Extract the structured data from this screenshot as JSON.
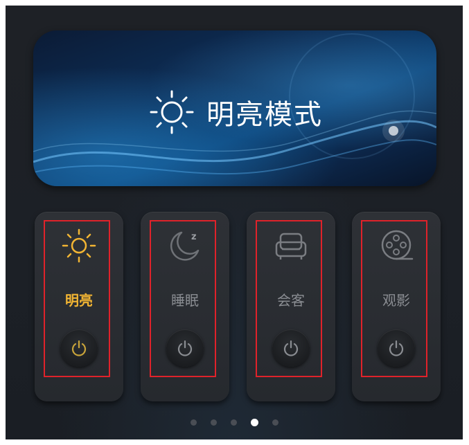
{
  "banner": {
    "title": "明亮模式",
    "icon": "sun-icon"
  },
  "modes": [
    {
      "label": "明亮",
      "icon": "sun-icon",
      "active": true
    },
    {
      "label": "睡眠",
      "icon": "moon-icon",
      "active": false
    },
    {
      "label": "会客",
      "icon": "sofa-icon",
      "active": false
    },
    {
      "label": "观影",
      "icon": "film-reel-icon",
      "active": false
    }
  ],
  "pagination": {
    "count": 5,
    "current": 4
  },
  "colors": {
    "active": "#f2b533",
    "inactive": "#8a8d92",
    "highlight_border": "#e0222a"
  }
}
